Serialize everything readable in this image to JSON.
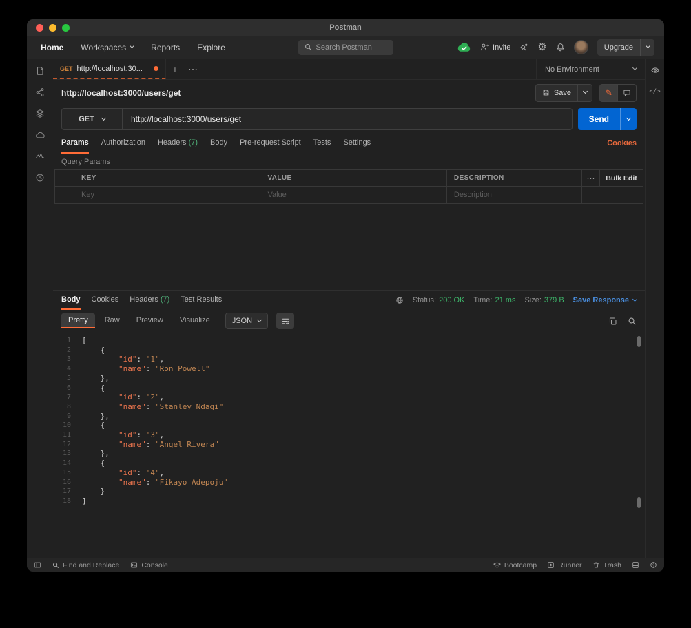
{
  "window": {
    "title": "Postman"
  },
  "nav": {
    "items": [
      {
        "label": "Home"
      },
      {
        "label": "Workspaces"
      },
      {
        "label": "Reports"
      },
      {
        "label": "Explore"
      }
    ],
    "search_placeholder": "Search Postman",
    "invite_label": "Invite",
    "upgrade_label": "Upgrade"
  },
  "tabbar": {
    "method": "GET",
    "title": "http://localhost:30...",
    "environment": "No Environment"
  },
  "request": {
    "title": "http://localhost:3000/users/get",
    "save_label": "Save",
    "method": "GET",
    "url": "http://localhost:3000/users/get",
    "send_label": "Send",
    "tabs": [
      {
        "label": "Params"
      },
      {
        "label": "Authorization"
      },
      {
        "label": "Headers",
        "count": "(7)"
      },
      {
        "label": "Body"
      },
      {
        "label": "Pre-request Script"
      },
      {
        "label": "Tests"
      },
      {
        "label": "Settings"
      }
    ],
    "cookies_label": "Cookies",
    "section_label": "Query Params",
    "table": {
      "columns": [
        "KEY",
        "VALUE",
        "DESCRIPTION"
      ],
      "bulk_edit_label": "Bulk Edit",
      "more_actions": "⋯",
      "placeholder_row": {
        "key": "Key",
        "value": "Value",
        "description": "Description"
      }
    }
  },
  "response": {
    "tabs": [
      {
        "label": "Body"
      },
      {
        "label": "Cookies"
      },
      {
        "label": "Headers",
        "count": "(7)"
      },
      {
        "label": "Test Results"
      }
    ],
    "meta": [
      {
        "label": "Status:",
        "value": "200 OK"
      },
      {
        "label": "Time:",
        "value": "21 ms"
      },
      {
        "label": "Size:",
        "value": "379 B"
      }
    ],
    "save_response_label": "Save Response",
    "view_tabs": [
      {
        "label": "Pretty"
      },
      {
        "label": "Raw"
      },
      {
        "label": "Preview"
      },
      {
        "label": "Visualize"
      }
    ],
    "language": "JSON"
  },
  "code": {
    "lines": [
      [
        {
          "c": "p",
          "t": "["
        }
      ],
      [
        {
          "c": "p",
          "t": "    {"
        }
      ],
      [
        {
          "c": "p",
          "t": "        "
        },
        {
          "c": "k",
          "t": "\"id\""
        },
        {
          "c": "p",
          "t": ": "
        },
        {
          "c": "s",
          "t": "\"1\""
        },
        {
          "c": "p",
          "t": ","
        }
      ],
      [
        {
          "c": "p",
          "t": "        "
        },
        {
          "c": "k",
          "t": "\"name\""
        },
        {
          "c": "p",
          "t": ": "
        },
        {
          "c": "s",
          "t": "\"Ron Powell\""
        }
      ],
      [
        {
          "c": "p",
          "t": "    },"
        }
      ],
      [
        {
          "c": "p",
          "t": "    {"
        }
      ],
      [
        {
          "c": "p",
          "t": "        "
        },
        {
          "c": "k",
          "t": "\"id\""
        },
        {
          "c": "p",
          "t": ": "
        },
        {
          "c": "s",
          "t": "\"2\""
        },
        {
          "c": "p",
          "t": ","
        }
      ],
      [
        {
          "c": "p",
          "t": "        "
        },
        {
          "c": "k",
          "t": "\"name\""
        },
        {
          "c": "p",
          "t": ": "
        },
        {
          "c": "s",
          "t": "\"Stanley Ndagi\""
        }
      ],
      [
        {
          "c": "p",
          "t": "    },"
        }
      ],
      [
        {
          "c": "p",
          "t": "    {"
        }
      ],
      [
        {
          "c": "p",
          "t": "        "
        },
        {
          "c": "k",
          "t": "\"id\""
        },
        {
          "c": "p",
          "t": ": "
        },
        {
          "c": "s",
          "t": "\"3\""
        },
        {
          "c": "p",
          "t": ","
        }
      ],
      [
        {
          "c": "p",
          "t": "        "
        },
        {
          "c": "k",
          "t": "\"name\""
        },
        {
          "c": "p",
          "t": ": "
        },
        {
          "c": "s",
          "t": "\"Angel Rivera\""
        }
      ],
      [
        {
          "c": "p",
          "t": "    },"
        }
      ],
      [
        {
          "c": "p",
          "t": "    {"
        }
      ],
      [
        {
          "c": "p",
          "t": "        "
        },
        {
          "c": "k",
          "t": "\"id\""
        },
        {
          "c": "p",
          "t": ": "
        },
        {
          "c": "s",
          "t": "\"4\""
        },
        {
          "c": "p",
          "t": ","
        }
      ],
      [
        {
          "c": "p",
          "t": "        "
        },
        {
          "c": "k",
          "t": "\"name\""
        },
        {
          "c": "p",
          "t": ": "
        },
        {
          "c": "s",
          "t": "\"Fikayo Adepoju\""
        }
      ],
      [
        {
          "c": "p",
          "t": "    }"
        }
      ],
      [
        {
          "c": "p",
          "t": "]"
        }
      ]
    ]
  },
  "footer": {
    "find_replace_label": "Find and Replace",
    "console_label": "Console",
    "bootcamp_label": "Bootcamp",
    "runner_label": "Runner",
    "trash_label": "Trash"
  },
  "colors": {
    "accent_orange": "#ff6c37",
    "send_blue": "#0265d2",
    "status_green": "#3db56a",
    "link_blue": "#4a90e2",
    "code_key": "#e8734d",
    "code_string": "#c08552"
  }
}
